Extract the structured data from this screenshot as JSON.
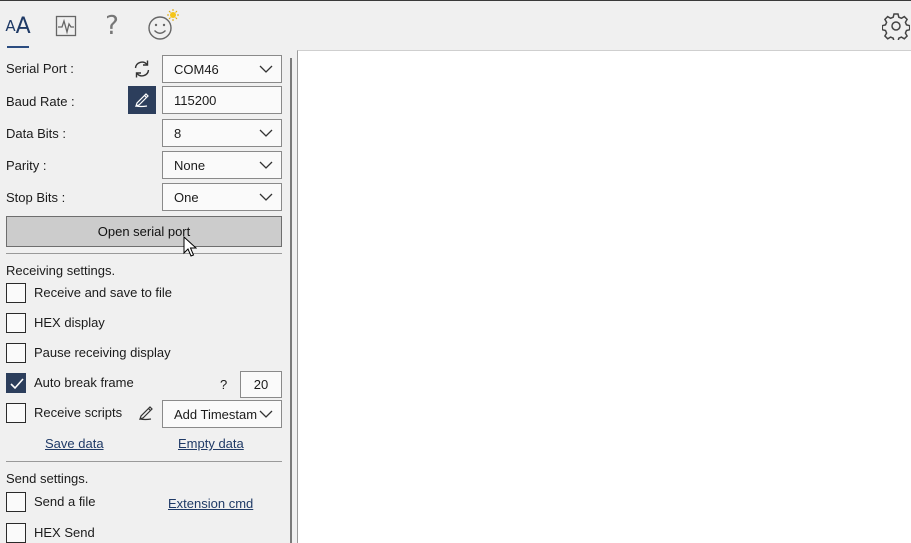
{
  "toolbar": {
    "font_icon_small": "A",
    "font_icon_large": "A",
    "help_glyph": "?",
    "icons": [
      "font-size-icon",
      "chart-icon",
      "help-icon",
      "smiley-icon",
      "settings-gear-icon"
    ]
  },
  "serial": {
    "port_label": "Serial Port :",
    "port_value": "COM46",
    "baud_label": "Baud Rate :",
    "baud_value": "115200",
    "databits_label": "Data Bits :",
    "databits_value": "8",
    "parity_label": "Parity :",
    "parity_value": "None",
    "stopbits_label": "Stop Bits :",
    "stopbits_value": "One",
    "open_button": "Open serial port"
  },
  "receiving": {
    "heading": "Receiving settings.",
    "save_to_file": "Receive and save to file",
    "hex_display": "HEX display",
    "pause_display": "Pause receiving display",
    "auto_break": "Auto break frame",
    "auto_break_checked": true,
    "break_help": "?",
    "break_value": "20",
    "receive_scripts": "Receive scripts",
    "scripts_option": "Add Timestamp",
    "save_data": "Save data",
    "empty_data": "Empty data"
  },
  "sending": {
    "heading": "Send settings.",
    "send_file": "Send a file",
    "extension_cmd": "Extension cmd",
    "hex_send": "HEX Send"
  },
  "colors": {
    "accent": "#2c3e5c",
    "link": "#1f3a66",
    "panel_bg": "#f0f0f0",
    "output_bg": "#ffffff"
  }
}
